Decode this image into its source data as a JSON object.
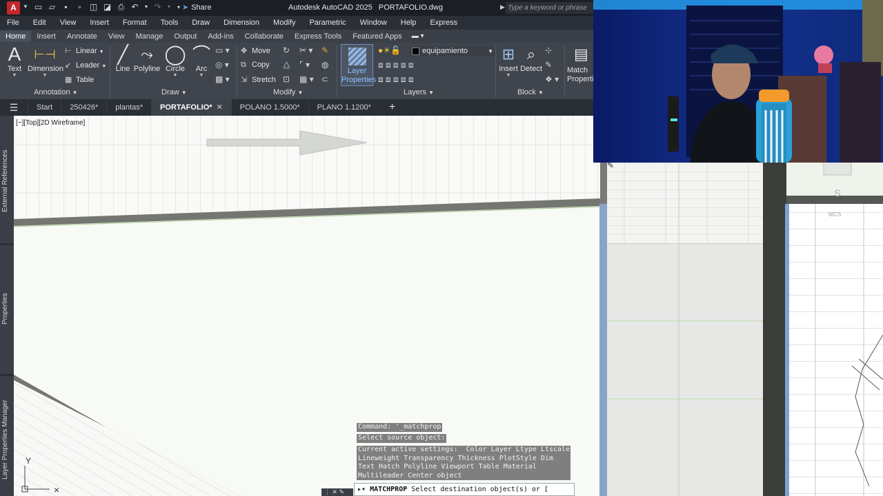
{
  "app": {
    "logo_letter": "A",
    "title": "Autodesk AutoCAD 2025   PORTAFOLIO.dwg",
    "share_label": "Share",
    "search_placeholder": "Type a keyword or phrase"
  },
  "menu": [
    "File",
    "Edit",
    "View",
    "Insert",
    "Format",
    "Tools",
    "Draw",
    "Dimension",
    "Modify",
    "Parametric",
    "Window",
    "Help",
    "Express"
  ],
  "ribbon_tabs": [
    "Home",
    "Insert",
    "Annotate",
    "View",
    "Manage",
    "Output",
    "Add-ins",
    "Collaborate",
    "Express Tools",
    "Featured Apps"
  ],
  "ribbon": {
    "annotation": {
      "title": "Annotation",
      "text": "Text",
      "dimension": "Dimension",
      "linear": "Linear",
      "leader": "Leader",
      "table": "Table"
    },
    "draw": {
      "title": "Draw",
      "line": "Line",
      "polyline": "Polyline",
      "circle": "Circle",
      "arc": "Arc"
    },
    "modify": {
      "title": "Modify",
      "move": "Move",
      "copy": "Copy",
      "stretch": "Stretch"
    },
    "layers": {
      "title": "Layers",
      "layer_properties": "Layer Properties",
      "current_layer": "equipamiento"
    },
    "block": {
      "title": "Block",
      "insert": "Insert",
      "detect": "Detect",
      "match_properties": "Match Properties"
    }
  },
  "file_tabs": [
    "Start",
    "250426*",
    "plantas*",
    "PORTAFOLIO*",
    "POLANO 1.5000*",
    "PLANO 1.1200*"
  ],
  "palettes": [
    "External References",
    "Properties",
    "Layer Properties Manager"
  ],
  "viewport_label": "[−][Top][2D Wireframe]",
  "wcs_label": "WCS",
  "compass_letter": "S",
  "ucs_y_label": "Y",
  "command": {
    "line1": "Command: '_matchprop",
    "line2": "Select source object:",
    "line3": "Current active settings:  Color Layer Ltype Ltscale\nLineweight Transparency Thickness PlotStyle Dim\nText Hatch Polyline Viewport Table Material\nMultileader Center object",
    "prompt_cmd": "MATCHPROP",
    "prompt_text": " Select destination object(s) or ["
  },
  "colors": {
    "canvas": "#f7faf5",
    "wall": "#6f716d",
    "ribbon": "#3f444d",
    "logo": "#c4262e",
    "accent": "#5aa0e6"
  }
}
